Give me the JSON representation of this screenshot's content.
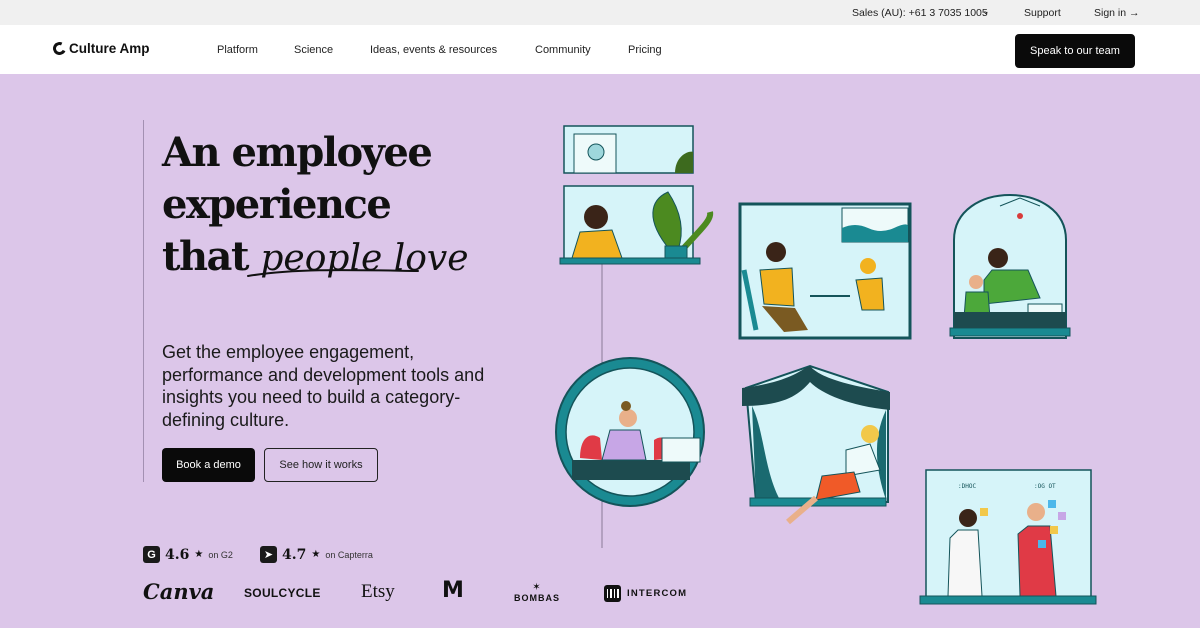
{
  "utility_bar": {
    "sales": "Sales (AU): +61 3 7035 1005",
    "support": "Support",
    "sign_in": "Sign in →"
  },
  "nav": {
    "logo": "Culture Amp",
    "items": [
      "Platform",
      "Science",
      "Ideas, events & resources",
      "Community",
      "Pricing"
    ],
    "cta": "Speak to our team"
  },
  "hero": {
    "headline_line1": "An employee",
    "headline_line2": "experience",
    "headline_line3": "that",
    "headline_script": "people love",
    "subcopy": "Get the employee engagement, performance and development tools and insights you need to build a category-defining culture.",
    "primary_button": "Book a demo",
    "secondary_button": "See how it works"
  },
  "ratings": [
    {
      "badge": "G",
      "score": "4.6",
      "star": "★",
      "source": "on G2"
    },
    {
      "badge": "➤",
      "score": "4.7",
      "star": "★",
      "source": "on Capterra"
    }
  ],
  "brands": {
    "canva": "Canva",
    "soulcycle": "SOULCYCLE",
    "etsy": "Etsy",
    "mcdonalds": "M",
    "bombas": "BOMBAS",
    "intercom": "INTERCOM"
  },
  "colors": {
    "background": "#dcc6e9",
    "teal": "#14545a",
    "panel": "#d6f4f9",
    "dark": "#0a0a0a"
  }
}
